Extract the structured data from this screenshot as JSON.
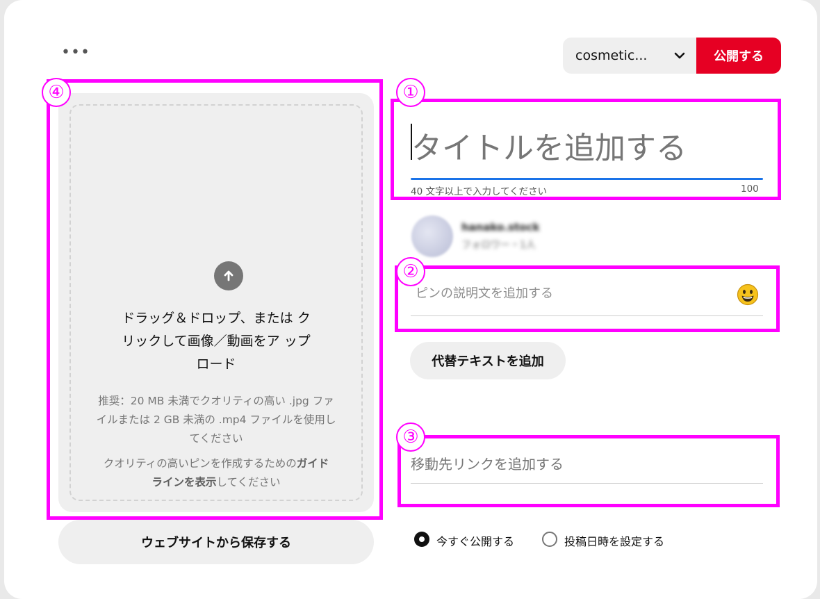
{
  "header": {
    "more_label": "•••",
    "board_select_value": "cosmetic...",
    "publish_label": "公開する"
  },
  "upload": {
    "main_text": "ドラッグ＆ドロップ、または クリックして画像／動画をア ップロード",
    "recommend_text": "推奨：20 MB 未満でクオリティの高い .jpg ファイルまたは 2 GB 未満の .mp4 ファイルを使用してください",
    "guide_prefix": "クオリティの高いピンを作成するための",
    "guide_link": "ガイドラインを表示",
    "guide_suffix": "してください",
    "save_from_web_label": "ウェブサイトから保存する"
  },
  "title": {
    "placeholder": "タイトルを追加する",
    "hint": "40 文字以上で入力してください",
    "counter": "100"
  },
  "user": {
    "name": "hanako.stock",
    "followers": "フォロワー・1人"
  },
  "description": {
    "placeholder": "ピンの説明文を追加する"
  },
  "alt_text_button": "代替テキストを追加",
  "link": {
    "placeholder": "移動先リンクを追加する"
  },
  "schedule": {
    "now_label": "今すぐ公開する",
    "later_label": "投稿日時を設定する"
  },
  "annotations": {
    "one": "①",
    "two": "②",
    "three": "③",
    "four": "④"
  },
  "colors": {
    "publish": "#e60023",
    "annotation": "#ff00ff",
    "focus_underline": "#1a73e8"
  },
  "icons": [
    "more-icon",
    "chevron-down-icon",
    "upload-arrow-icon",
    "smiley-emoji-icon"
  ]
}
